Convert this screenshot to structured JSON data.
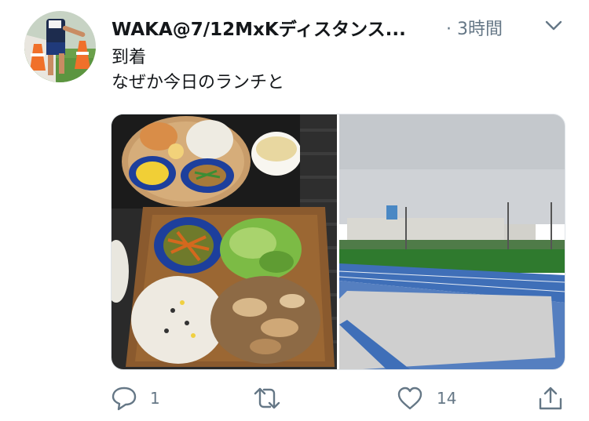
{
  "tweet": {
    "author_name": "WAKA@7/12MxKディスタンス...",
    "time": "3時間",
    "lines": [
      "到着",
      "なぜか今日のランチと"
    ]
  },
  "actions": {
    "reply_count": "1",
    "retweet_count": "",
    "like_count": "14"
  },
  "media": {
    "items": [
      {
        "icon": "food-plates-photo"
      },
      {
        "icon": "running-track-photo"
      }
    ]
  },
  "colors": {
    "text": "#14171a",
    "secondary_text": "#657786",
    "track_blue": "#3f6fb8",
    "field_green": "#2f7a2e"
  }
}
